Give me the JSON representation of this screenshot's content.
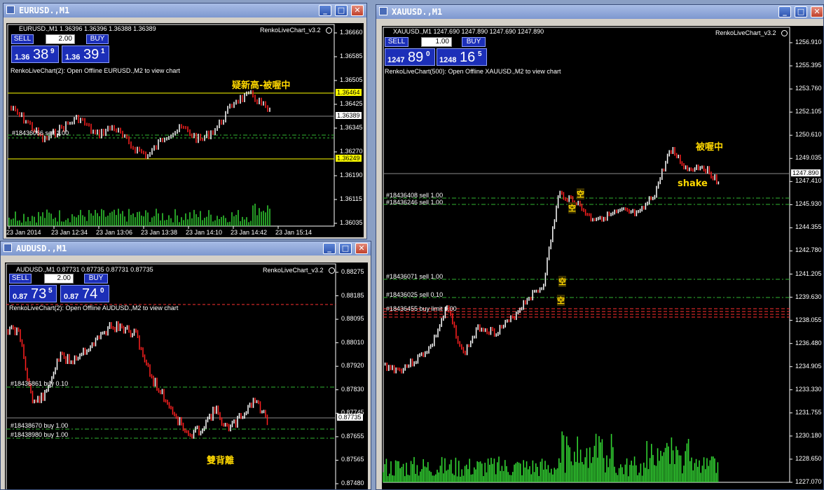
{
  "windows": [
    {
      "id": "eurusd",
      "title": "EURUSD.,M1",
      "header": "EURUSD.,M1  1.36396 1.36396 1.36388 1.36389",
      "indicator": "RenkoLiveChart_v3.2",
      "info": "RenkoLiveChart(2): Open Offline EURUSD.,M2 to view chart",
      "sell_label": "SELL",
      "buy_label": "BUY",
      "lot": "2.00",
      "bid": {
        "prefix": "1.36",
        "big": "38",
        "sup": "9"
      },
      "ask": {
        "prefix": "1.36",
        "big": "39",
        "sup": "1"
      },
      "annotation": "疑新高-被喔中",
      "order_labels": [
        "#18436066 sell 1.00"
      ],
      "price_axis": [
        "1.36660",
        "1.36585",
        "1.36505",
        "1.36425",
        "1.36345",
        "1.36270",
        "1.36190",
        "1.36115",
        "1.36035"
      ],
      "price_tags": [
        "1.36464",
        "1.36389",
        "1.36249"
      ],
      "time_axis": [
        "23 Jan 2014",
        "23 Jan 12:34",
        "23 Jan 13:06",
        "23 Jan 13:38",
        "23 Jan 14:10",
        "23 Jan 14:42",
        "23 Jan 15:14"
      ]
    },
    {
      "id": "audusd",
      "title": "AUDUSD.,M1",
      "header": "AUDUSD.,M1  0.87731 0.87735 0.87731 0.87735",
      "indicator": "RenkoLiveChart_v3.2",
      "info": "RenkoLiveChart(2): Open Offline AUDUSD.,M2 to view chart",
      "sell_label": "SELL",
      "buy_label": "BUY",
      "lot": "2.00",
      "bid": {
        "prefix": "0.87",
        "big": "73",
        "sup": "5"
      },
      "ask": {
        "prefix": "0.87",
        "big": "74",
        "sup": "0"
      },
      "annotation": "雙背離",
      "order_labels": [
        "#18436861 buy 0.10",
        "#18438670 buy 1.00",
        "#18438980 buy 1.00"
      ],
      "price_axis": [
        "0.88275",
        "0.88185",
        "0.88095",
        "0.88010",
        "0.87920",
        "0.87830",
        "0.87745",
        "0.87655",
        "0.87565",
        "0.87480"
      ],
      "price_tags": [
        "0.87735"
      ]
    },
    {
      "id": "xauusd",
      "title": "XAUUSD.,M1",
      "header": "XAUUSD.,M1  1247.690 1247.890 1247.690 1247.890",
      "indicator": "RenkoLiveChart_v3.2",
      "info": "RenkoLiveChart(500): Open Offline XAUUSD.,M2 to view chart",
      "sell_label": "SELL",
      "buy_label": "BUY",
      "lot": "1.00",
      "bid": {
        "prefix": "1247",
        "big": "89",
        "sup": "0"
      },
      "ask": {
        "prefix": "1248",
        "big": "16",
        "sup": "5"
      },
      "annotation": "被喔中",
      "annotation2": "shake",
      "annotation3": "空",
      "order_labels": [
        "#18436408 sell 1.00",
        "#18436246 sell 1.00",
        "#18436071 sell 1.00",
        "#18436025 sell 0.10",
        "#18436455 buy limit 1.00"
      ],
      "price_axis": [
        "1256.910",
        "1255.395",
        "1253.760",
        "1252.105",
        "1250.610",
        "1249.035",
        "1247.410",
        "1245.930",
        "1244.355",
        "1242.780",
        "1241.205",
        "1239.630",
        "1238.055",
        "1236.480",
        "1234.905",
        "1233.330",
        "1231.755",
        "1230.180",
        "1228.650",
        "1227.070"
      ],
      "price_tags": [
        "1247.890"
      ]
    }
  ],
  "colors": {
    "bull": "#ffffff",
    "bear": "#ff2020",
    "volume": "#32d232",
    "order_line": "#32b432",
    "limit_line": "#ff3030",
    "annotation": "#ffd800",
    "panel": "#1c2fb8"
  },
  "icons": [
    "chart-window-icon",
    "minimize-icon",
    "maximize-icon",
    "close-icon",
    "smiley-icon"
  ]
}
